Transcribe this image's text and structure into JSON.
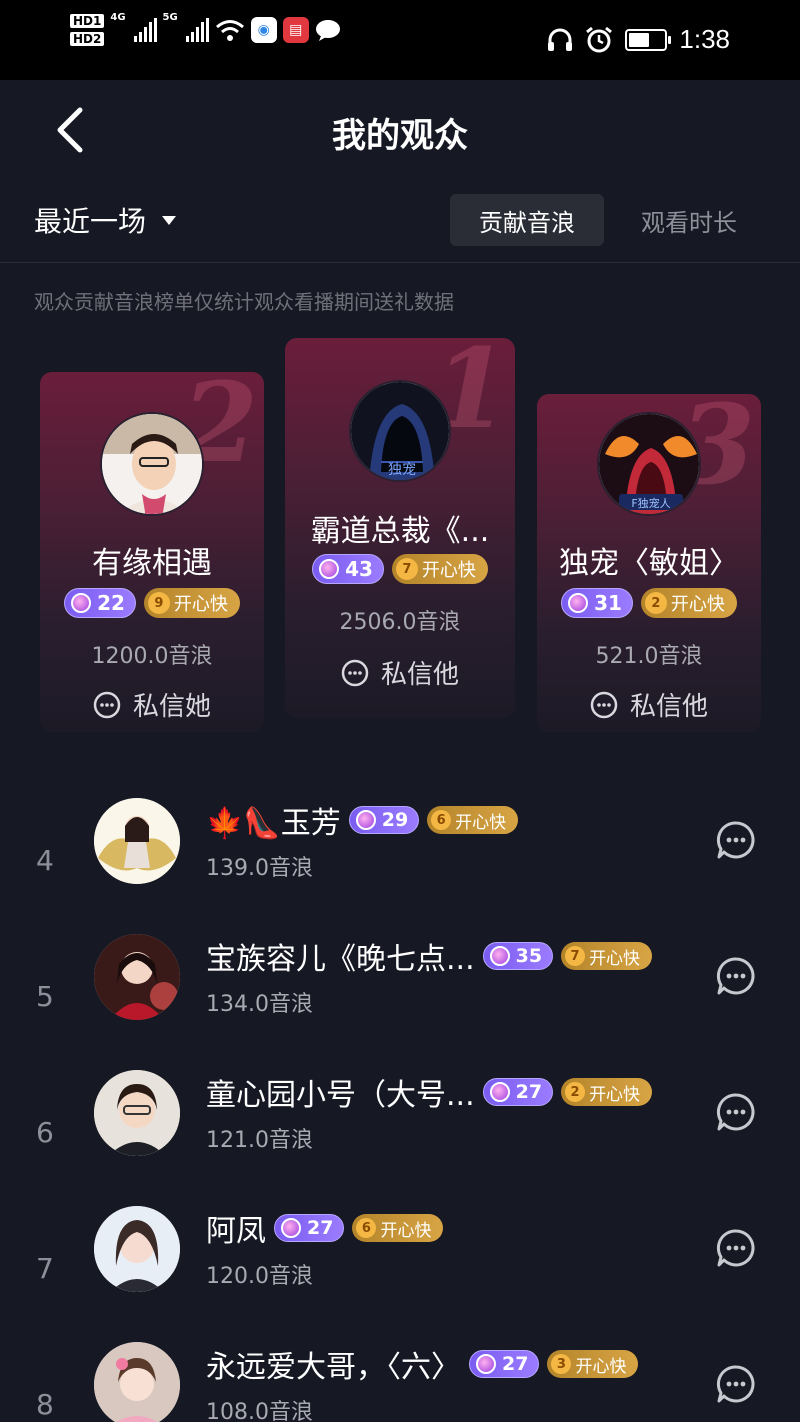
{
  "status_bar": {
    "hd1": "HD1",
    "hd2": "HD2",
    "net1": "4G",
    "net2": "5G",
    "time": "1:38"
  },
  "header": {
    "title": "我的观众",
    "back_icon": "back-arrow-icon"
  },
  "filter": {
    "selected": "最近一场"
  },
  "tabs": [
    {
      "label": "贡献音浪",
      "active": true
    },
    {
      "label": "观看时长",
      "active": false
    }
  ],
  "notice": "观众贡献音浪榜单仅统计观众看播期间送礼数据",
  "podium": [
    {
      "rank": "2",
      "name": "有缘相遇",
      "level": "22",
      "fan_level": "9",
      "fan_label": "开心快",
      "amount": "1200.0音浪",
      "dm_label": "私信她"
    },
    {
      "rank": "1",
      "name": "霸道总裁《...",
      "level": "43",
      "fan_level": "7",
      "fan_label": "开心快",
      "amount": "2506.0音浪",
      "dm_label": "私信他"
    },
    {
      "rank": "3",
      "name": "独宠〈敏姐〉",
      "level": "31",
      "fan_level": "2",
      "fan_label": "开心快",
      "amount": "521.0音浪",
      "dm_label": "私信他"
    }
  ],
  "list": [
    {
      "rank": "4",
      "name": "🍁👠玉芳",
      "level": "29",
      "fan_level": "6",
      "fan_label": "开心快",
      "amount": "139.0音浪"
    },
    {
      "rank": "5",
      "name": "宝族容儿《晚七点...",
      "level": "35",
      "fan_level": "7",
      "fan_label": "开心快",
      "amount": "134.0音浪"
    },
    {
      "rank": "6",
      "name": "童心园小号（大号...",
      "level": "27",
      "fan_level": "2",
      "fan_label": "开心快",
      "amount": "121.0音浪"
    },
    {
      "rank": "7",
      "name": "阿凤",
      "level": "27",
      "fan_level": "6",
      "fan_label": "开心快",
      "amount": "120.0音浪"
    },
    {
      "rank": "8",
      "name": "永远爱大哥，〈六〉",
      "level": "27",
      "fan_level": "3",
      "fan_label": "开心快",
      "amount": "108.0音浪"
    }
  ],
  "colors": {
    "background": "#161823",
    "level_badge": "#8b6cf7",
    "fan_badge": "#c99538",
    "card_top": "#6a1e3a"
  }
}
